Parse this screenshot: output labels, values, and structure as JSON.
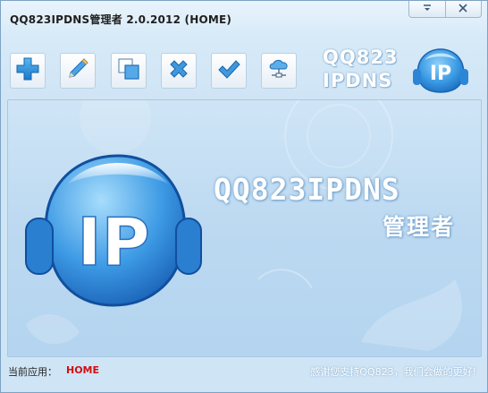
{
  "window": {
    "title": "QQ823IPDNS管理者 2.0.2012 (HOME)",
    "controls": {
      "menu_icon": "chevron-down-icon",
      "close_icon": "close-icon"
    }
  },
  "toolbar": {
    "buttons": [
      {
        "name": "add",
        "icon": "plus-icon"
      },
      {
        "name": "edit",
        "icon": "pencil-icon"
      },
      {
        "name": "copy",
        "icon": "copy-icon"
      },
      {
        "name": "delete",
        "icon": "x-icon"
      },
      {
        "name": "apply",
        "icon": "checkmark-icon"
      },
      {
        "name": "network",
        "icon": "cloud-network-icon"
      }
    ]
  },
  "brand": {
    "small_line1": "QQ823",
    "small_line2": "IPDNS",
    "logo_text": "IP"
  },
  "hero": {
    "title": "QQ823IPDNS",
    "subtitle": "管理者",
    "logo_text": "IP"
  },
  "status": {
    "label": "当前应用：",
    "value": "HOME",
    "thanks": "感谢您支持QQ823，我们会做的更好!"
  },
  "colors": {
    "accent_blue": "#3d8fd6",
    "status_value": "#d01010",
    "panel_bg": "#bcd9f1"
  }
}
